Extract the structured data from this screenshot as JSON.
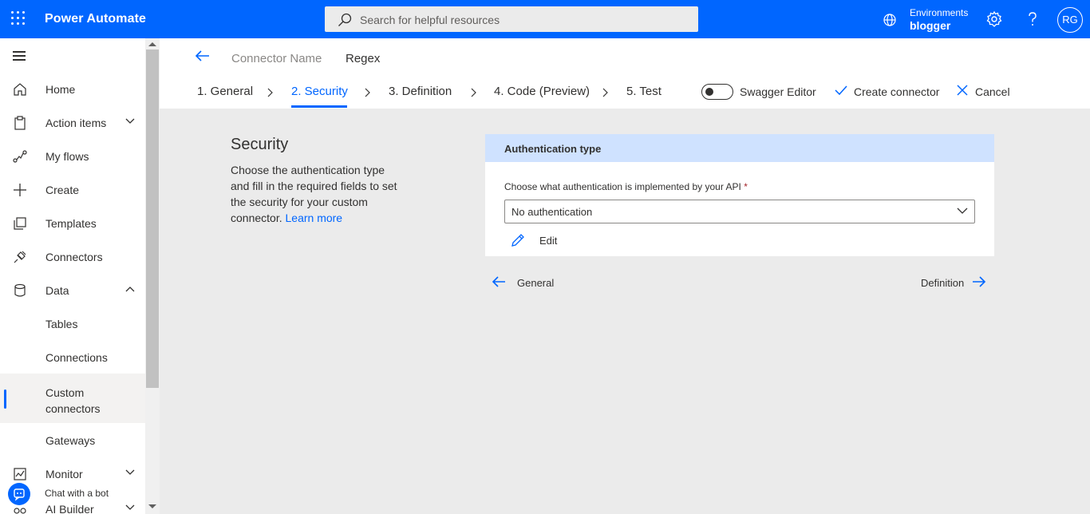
{
  "app": {
    "title": "Power Automate"
  },
  "search": {
    "placeholder": "Search for helpful resources"
  },
  "environment": {
    "label": "Environments",
    "name": "blogger"
  },
  "user": {
    "initials": "RG"
  },
  "sidebar": {
    "items": [
      {
        "label": "Home",
        "icon": "home-icon"
      },
      {
        "label": "Action items",
        "icon": "clipboard-icon"
      },
      {
        "label": "My flows",
        "icon": "flow-icon"
      },
      {
        "label": "Create",
        "icon": "plus-icon"
      },
      {
        "label": "Templates",
        "icon": "templates-icon"
      },
      {
        "label": "Connectors",
        "icon": "plug-icon"
      },
      {
        "label": "Data",
        "icon": "database-icon"
      },
      {
        "label": "Tables"
      },
      {
        "label": "Connections"
      },
      {
        "label": "Custom connectors"
      },
      {
        "label": "Gateways"
      },
      {
        "label": "Monitor",
        "icon": "monitor-icon"
      },
      {
        "label": "AI Builder",
        "icon": "ai-builder-icon"
      }
    ],
    "chat_bot_label": "Chat with a bot"
  },
  "header": {
    "connector_name_label": "Connector Name",
    "connector_name_value": "Regex",
    "steps": [
      "1. General",
      "2. Security",
      "3. Definition",
      "4. Code (Preview)",
      "5. Test"
    ],
    "active_step": "2. Security",
    "swagger_label": "Swagger Editor",
    "create_label": "Create connector",
    "cancel_label": "Cancel"
  },
  "security": {
    "title": "Security",
    "description": "Choose the authentication type and fill in the required fields to set the security for your custom connector.",
    "learn_more": "Learn more"
  },
  "auth": {
    "header": "Authentication type",
    "question": "Choose what authentication is implemented by your API",
    "required_mark": "*",
    "selected": "No authentication",
    "edit_label": "Edit"
  },
  "footer_nav": {
    "prev": "General",
    "next": "Definition"
  },
  "colors": {
    "brand": "#0066ff",
    "auth_header": "#cfe2ff",
    "page_bg": "#ebebeb"
  }
}
